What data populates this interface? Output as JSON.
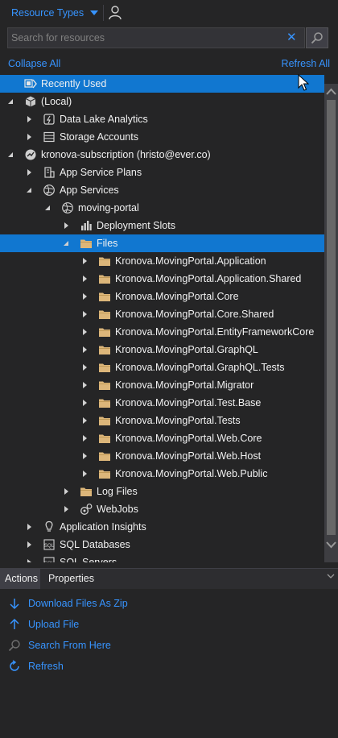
{
  "header": {
    "resource_types_label": "Resource Types"
  },
  "search": {
    "placeholder": "Search for resources",
    "value": "",
    "clear_glyph": "✕"
  },
  "links": {
    "collapse_all": "Collapse All",
    "refresh_all": "Refresh All"
  },
  "tree": {
    "rows": [
      {
        "label": "Recently Used",
        "depth": 0,
        "expander": "none",
        "icon": "recently-used-icon",
        "selected": true
      },
      {
        "label": "(Local)",
        "depth": 0,
        "expander": "expanded",
        "icon": "cube-icon",
        "selected": false
      },
      {
        "label": "Data Lake Analytics",
        "depth": 1,
        "expander": "collapsed",
        "icon": "data-lake-icon",
        "selected": false
      },
      {
        "label": "Storage Accounts",
        "depth": 1,
        "expander": "collapsed",
        "icon": "storage-icon",
        "selected": false
      },
      {
        "label": "kronova-subscription (hristo@ever.co)",
        "depth": 0,
        "expander": "expanded",
        "icon": "subscription-icon",
        "selected": false
      },
      {
        "label": "App Service Plans",
        "depth": 1,
        "expander": "collapsed",
        "icon": "app-service-plan-icon",
        "selected": false
      },
      {
        "label": "App Services",
        "depth": 1,
        "expander": "expanded",
        "icon": "globe-icon",
        "selected": false
      },
      {
        "label": "moving-portal",
        "depth": 2,
        "expander": "expanded",
        "icon": "globe-icon",
        "selected": false
      },
      {
        "label": "Deployment Slots",
        "depth": 3,
        "expander": "collapsed",
        "icon": "deployment-slots-icon",
        "selected": false
      },
      {
        "label": "Files",
        "depth": 3,
        "expander": "expanded",
        "icon": "folder-icon",
        "selected": true
      },
      {
        "label": "Kronova.MovingPortal.Application",
        "depth": 4,
        "expander": "collapsed",
        "icon": "folder-icon",
        "selected": false
      },
      {
        "label": "Kronova.MovingPortal.Application.Shared",
        "depth": 4,
        "expander": "collapsed",
        "icon": "folder-icon",
        "selected": false
      },
      {
        "label": "Kronova.MovingPortal.Core",
        "depth": 4,
        "expander": "collapsed",
        "icon": "folder-icon",
        "selected": false
      },
      {
        "label": "Kronova.MovingPortal.Core.Shared",
        "depth": 4,
        "expander": "collapsed",
        "icon": "folder-icon",
        "selected": false
      },
      {
        "label": "Kronova.MovingPortal.EntityFrameworkCore",
        "depth": 4,
        "expander": "collapsed",
        "icon": "folder-icon",
        "selected": false
      },
      {
        "label": "Kronova.MovingPortal.GraphQL",
        "depth": 4,
        "expander": "collapsed",
        "icon": "folder-icon",
        "selected": false
      },
      {
        "label": "Kronova.MovingPortal.GraphQL.Tests",
        "depth": 4,
        "expander": "collapsed",
        "icon": "folder-icon",
        "selected": false
      },
      {
        "label": "Kronova.MovingPortal.Migrator",
        "depth": 4,
        "expander": "collapsed",
        "icon": "folder-icon",
        "selected": false
      },
      {
        "label": "Kronova.MovingPortal.Test.Base",
        "depth": 4,
        "expander": "collapsed",
        "icon": "folder-icon",
        "selected": false
      },
      {
        "label": "Kronova.MovingPortal.Tests",
        "depth": 4,
        "expander": "collapsed",
        "icon": "folder-icon",
        "selected": false
      },
      {
        "label": "Kronova.MovingPortal.Web.Core",
        "depth": 4,
        "expander": "collapsed",
        "icon": "folder-icon",
        "selected": false
      },
      {
        "label": "Kronova.MovingPortal.Web.Host",
        "depth": 4,
        "expander": "collapsed",
        "icon": "folder-icon",
        "selected": false
      },
      {
        "label": "Kronova.MovingPortal.Web.Public",
        "depth": 4,
        "expander": "collapsed",
        "icon": "folder-icon",
        "selected": false
      },
      {
        "label": "Log Files",
        "depth": 3,
        "expander": "collapsed",
        "icon": "folder-icon",
        "selected": false
      },
      {
        "label": "WebJobs",
        "depth": 3,
        "expander": "collapsed",
        "icon": "webjobs-icon",
        "selected": false
      },
      {
        "label": "Application Insights",
        "depth": 1,
        "expander": "collapsed",
        "icon": "lightbulb-icon",
        "selected": false
      },
      {
        "label": "SQL Databases",
        "depth": 1,
        "expander": "collapsed",
        "icon": "sql-database-icon",
        "selected": false
      },
      {
        "label": "SQL Servers",
        "depth": 1,
        "expander": "collapsed",
        "icon": "sql-server-icon",
        "selected": false
      }
    ]
  },
  "bottom_panel": {
    "tabs": [
      {
        "label": "Actions",
        "active": true
      },
      {
        "label": "Properties",
        "active": false
      }
    ],
    "actions": [
      {
        "label": "Download Files As Zip",
        "icon": "download-arrow-icon"
      },
      {
        "label": "Upload File",
        "icon": "upload-arrow-icon"
      },
      {
        "label": "Search From Here",
        "icon": "search-icon"
      },
      {
        "label": "Refresh",
        "icon": "refresh-icon"
      }
    ]
  },
  "colors": {
    "accent": "#3794ff",
    "selection": "#1177d0",
    "background": "#252526",
    "folder": "#dcb67a"
  }
}
